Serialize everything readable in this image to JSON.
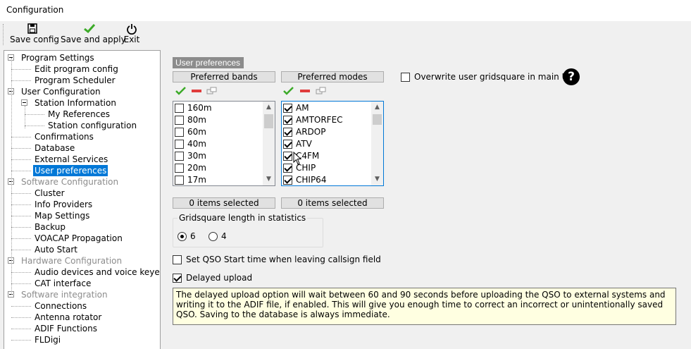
{
  "window": {
    "title": "Configuration"
  },
  "toolbar": {
    "save_config": "Save config",
    "save_apply": "Save and apply",
    "exit": "Exit"
  },
  "tree": [
    {
      "label": "Program Settings",
      "level": 0,
      "expander": true,
      "disabled": false
    },
    {
      "label": "Edit program config",
      "level": 1,
      "expander": false,
      "disabled": false
    },
    {
      "label": "Program Scheduler",
      "level": 1,
      "expander": false,
      "disabled": false
    },
    {
      "label": "User Configuration",
      "level": 0,
      "expander": true,
      "disabled": false
    },
    {
      "label": "Station Information",
      "level": 1,
      "expander": true,
      "disabled": false
    },
    {
      "label": "My References",
      "level": 2,
      "expander": false,
      "disabled": false
    },
    {
      "label": "Station configuration",
      "level": 2,
      "expander": false,
      "disabled": false
    },
    {
      "label": "Confirmations",
      "level": 1,
      "expander": false,
      "disabled": false
    },
    {
      "label": "Database",
      "level": 1,
      "expander": false,
      "disabled": false
    },
    {
      "label": "External Services",
      "level": 1,
      "expander": false,
      "disabled": false
    },
    {
      "label": "User preferences",
      "level": 1,
      "expander": false,
      "disabled": false,
      "selected": true
    },
    {
      "label": "Software Configuration",
      "level": 0,
      "expander": true,
      "disabled": true
    },
    {
      "label": "Cluster",
      "level": 1,
      "expander": false,
      "disabled": false
    },
    {
      "label": "Info Providers",
      "level": 1,
      "expander": false,
      "disabled": false
    },
    {
      "label": "Map Settings",
      "level": 1,
      "expander": false,
      "disabled": false
    },
    {
      "label": "Backup",
      "level": 1,
      "expander": false,
      "disabled": false
    },
    {
      "label": "VOACAP Propagation",
      "level": 1,
      "expander": false,
      "disabled": false
    },
    {
      "label": "Auto Start",
      "level": 1,
      "expander": false,
      "disabled": false
    },
    {
      "label": "Hardware Configuration",
      "level": 0,
      "expander": true,
      "disabled": true
    },
    {
      "label": "Audio devices and voice keyer",
      "level": 1,
      "expander": false,
      "disabled": false
    },
    {
      "label": "CAT interface",
      "level": 1,
      "expander": false,
      "disabled": false
    },
    {
      "label": "Software integration",
      "level": 0,
      "expander": true,
      "disabled": true
    },
    {
      "label": "Connections",
      "level": 1,
      "expander": false,
      "disabled": false
    },
    {
      "label": "Antenna rotator",
      "level": 1,
      "expander": false,
      "disabled": false
    },
    {
      "label": "ADIF Functions",
      "level": 1,
      "expander": false,
      "disabled": false
    },
    {
      "label": "FLDigi",
      "level": 1,
      "expander": false,
      "disabled": false
    }
  ],
  "panel": {
    "title": "User preferences",
    "bands_header": "Preferred bands",
    "modes_header": "Preferred modes",
    "bands": [
      {
        "label": "160m",
        "checked": false
      },
      {
        "label": "80m",
        "checked": false
      },
      {
        "label": "60m",
        "checked": false
      },
      {
        "label": "40m",
        "checked": false
      },
      {
        "label": "30m",
        "checked": false
      },
      {
        "label": "20m",
        "checked": false
      },
      {
        "label": "17m",
        "checked": false
      }
    ],
    "modes": [
      {
        "label": "AM",
        "checked": true
      },
      {
        "label": "AMTORFEC",
        "checked": true
      },
      {
        "label": "ARDOP",
        "checked": true
      },
      {
        "label": "ATV",
        "checked": true
      },
      {
        "label": "C4FM",
        "checked": true
      },
      {
        "label": "CHIP",
        "checked": true
      },
      {
        "label": "CHIP64",
        "checked": true
      }
    ],
    "bands_count": "0 items selected",
    "modes_count": "0 items selected",
    "overwrite_label": "Overwrite user gridsquare in main UI",
    "overwrite_checked": false,
    "grid_group_title": "Gridsquare length in statistics",
    "grid_options": [
      "6",
      "4"
    ],
    "grid_selected": "6",
    "qso_start_label": "Set QSO Start time when leaving callsign field",
    "qso_start_checked": false,
    "delayed_label": "Delayed upload",
    "delayed_checked": true,
    "info_text": "The delayed upload option will wait between 60 and 90 seconds before uploading the QSO to external systems and writing it to the ADIF file, if enabled. This will give you enough time to correct an incorrect or unintentionally saved QSO. Saving to the database is always immediate.",
    "help_glyph": "?"
  },
  "icons": {
    "save": "floppy-icon",
    "apply": "checkmark-icon",
    "exit": "power-icon",
    "check_all": "check-all-icon",
    "uncheck_all": "uncheck-all-icon",
    "invert": "invert-selection-icon",
    "help": "help-icon"
  },
  "colors": {
    "selection": "#0078d7",
    "info_background": "#ffffe1",
    "green_check": "#3caa28",
    "red_minus": "#e03c3c"
  }
}
